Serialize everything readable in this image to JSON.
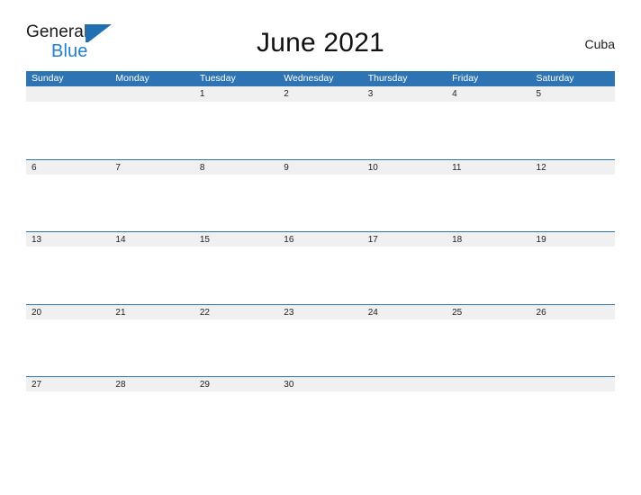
{
  "brand": {
    "name_top": "General",
    "name_bottom": "Blue",
    "logo_icon": "blue-triangle-flag-icon",
    "color_dark": "#1a1a1a",
    "color_blue": "#1f7fd0"
  },
  "header": {
    "title": "June 2021",
    "locale": "Cuba"
  },
  "colors": {
    "header_blue": "#2e74b5",
    "rule_blue": "#2e74b5",
    "date_band_gray": "#f0f0f0",
    "page_background": "#ffffff",
    "text_dark": "#222222",
    "weekday_text": "#ffffff"
  },
  "calendar": {
    "month": "June",
    "year": "2021",
    "weekdays": [
      "Sunday",
      "Monday",
      "Tuesday",
      "Wednesday",
      "Thursday",
      "Friday",
      "Saturday"
    ],
    "weeks": [
      {
        "rule": false,
        "days": [
          "",
          "",
          "1",
          "2",
          "3",
          "4",
          "5"
        ]
      },
      {
        "rule": true,
        "days": [
          "6",
          "7",
          "8",
          "9",
          "10",
          "11",
          "12"
        ]
      },
      {
        "rule": true,
        "days": [
          "13",
          "14",
          "15",
          "16",
          "17",
          "18",
          "19"
        ]
      },
      {
        "rule": true,
        "days": [
          "20",
          "21",
          "22",
          "23",
          "24",
          "25",
          "26"
        ]
      },
      {
        "rule": true,
        "days": [
          "27",
          "28",
          "29",
          "30",
          "",
          "",
          ""
        ]
      }
    ]
  }
}
